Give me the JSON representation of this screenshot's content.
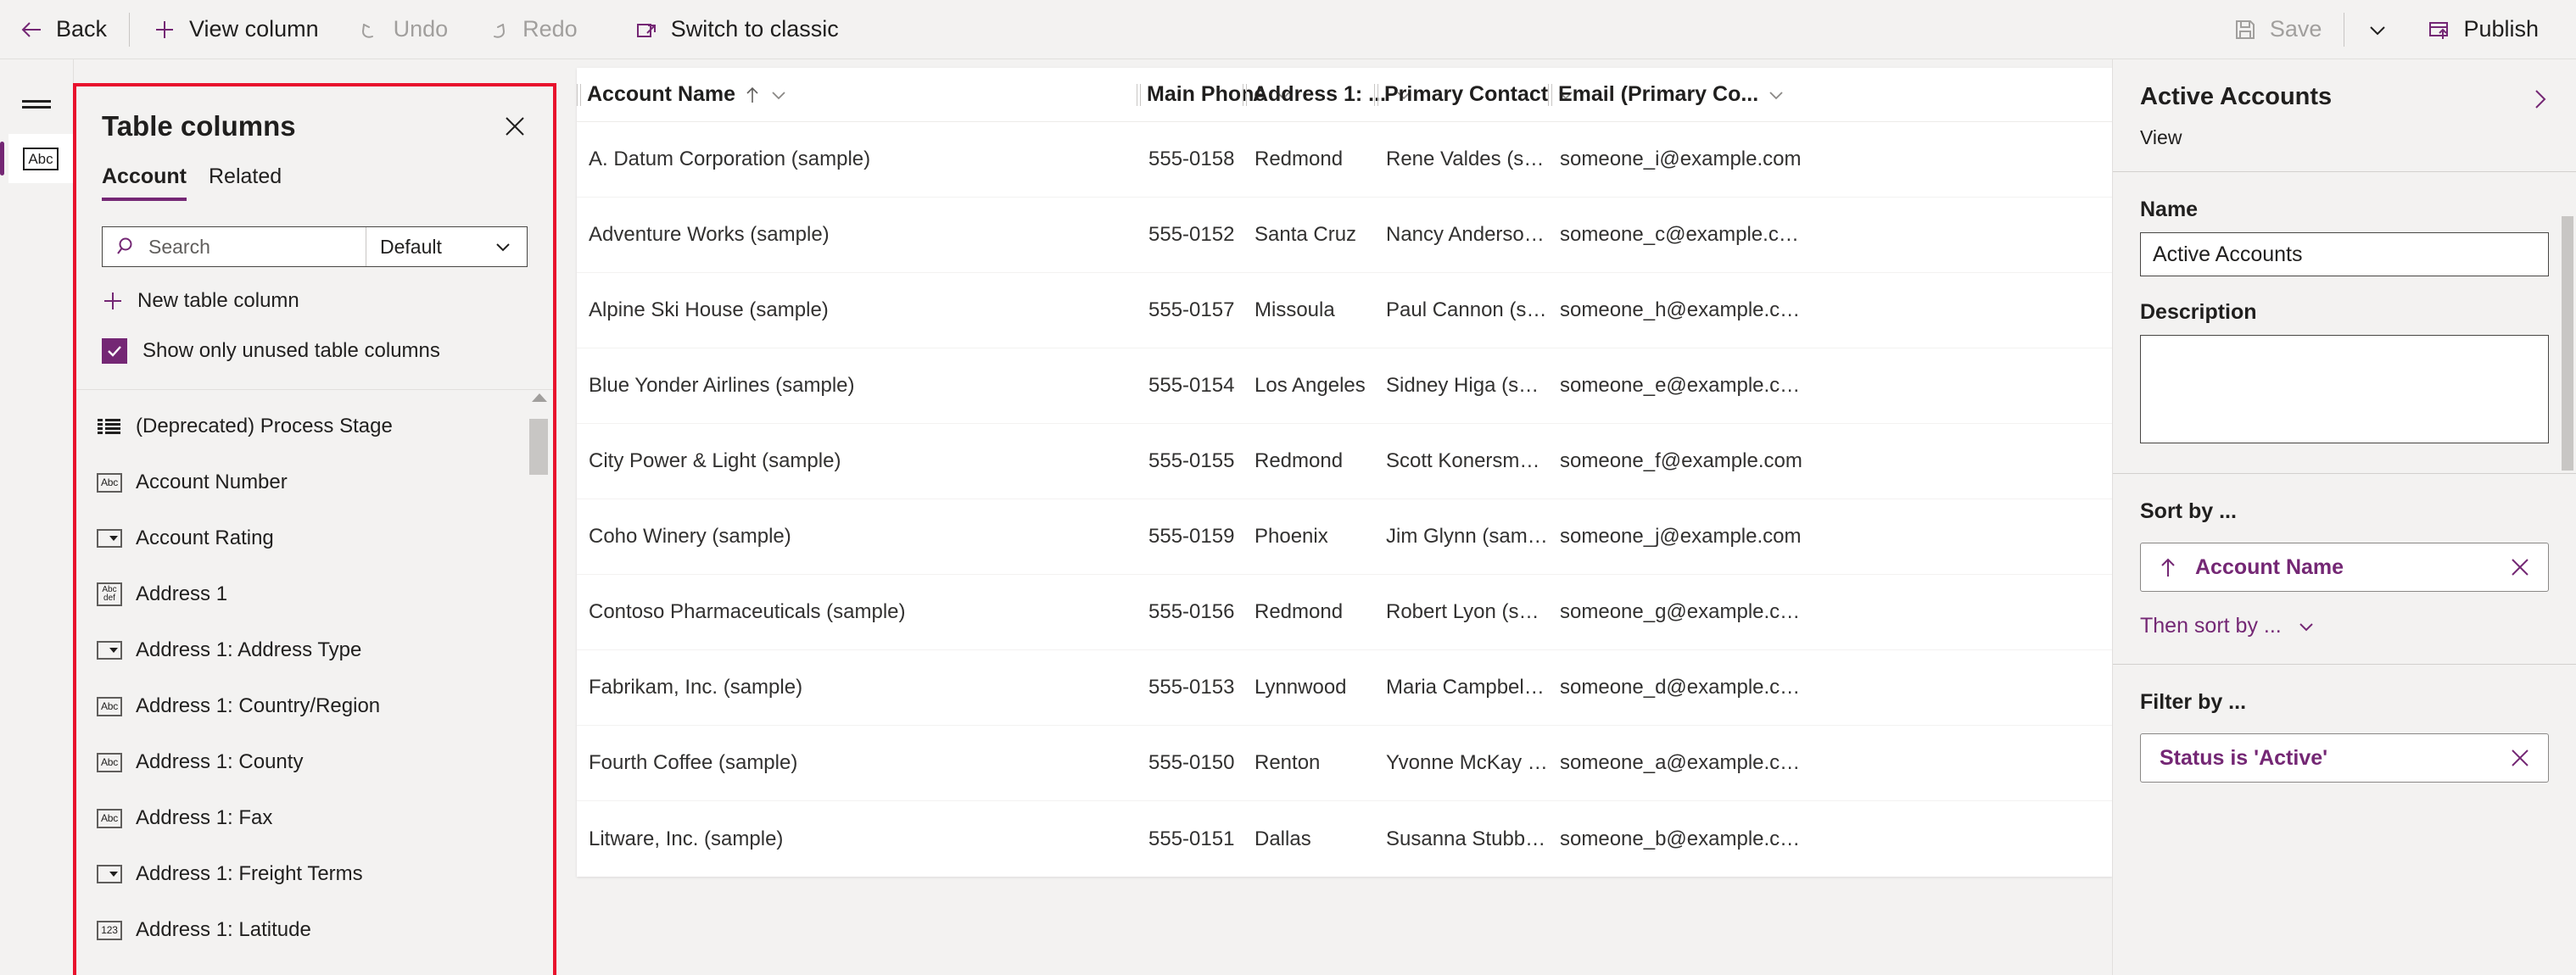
{
  "commandbar": {
    "left": [
      {
        "id": "back",
        "label": "Back",
        "icon": "arrow-left-icon",
        "disabled": false
      },
      {
        "id": "view-column",
        "label": "View column",
        "icon": "plus-icon",
        "disabled": false
      },
      {
        "id": "undo",
        "label": "Undo",
        "icon": "undo-icon",
        "disabled": true
      },
      {
        "id": "redo",
        "label": "Redo",
        "icon": "redo-icon",
        "disabled": true
      },
      {
        "id": "switch-classic",
        "label": "Switch to classic",
        "icon": "open-external-icon",
        "disabled": false
      }
    ],
    "right": [
      {
        "id": "save",
        "label": "Save",
        "icon": "save-icon",
        "disabled": true
      },
      {
        "id": "publish",
        "label": "Publish",
        "icon": "publish-icon",
        "disabled": false
      }
    ],
    "save_chevron": "chevron-down-icon"
  },
  "rail": {
    "menu_icon": "hamburger-icon",
    "item_icon_label": "Abc",
    "item_name": "columns-tool"
  },
  "columns_panel": {
    "title": "Table columns",
    "close_icon": "close-icon",
    "tabs": [
      {
        "label": "Account",
        "active": true
      },
      {
        "label": "Related",
        "active": false
      }
    ],
    "search_placeholder": "Search",
    "search_value": "",
    "search_icon": "search-icon",
    "filter_select_value": "Default",
    "filter_select_icon": "chevron-down-icon",
    "new_column_label": "New table column",
    "new_column_icon": "plus-icon",
    "checkbox_label": "Show only unused table columns",
    "checkbox_checked": true,
    "list": [
      {
        "label": "(Deprecated) Process Stage",
        "icon": "list-type-icon"
      },
      {
        "label": "Account Number",
        "icon": "text-type-icon"
      },
      {
        "label": "Account Rating",
        "icon": "choice-type-icon"
      },
      {
        "label": "Address 1",
        "icon": "multiline-text-type-icon"
      },
      {
        "label": "Address 1: Address Type",
        "icon": "choice-type-icon"
      },
      {
        "label": "Address 1: Country/Region",
        "icon": "text-type-icon"
      },
      {
        "label": "Address 1: County",
        "icon": "text-type-icon"
      },
      {
        "label": "Address 1: Fax",
        "icon": "text-type-icon"
      },
      {
        "label": "Address 1: Freight Terms",
        "icon": "choice-type-icon"
      },
      {
        "label": "Address 1: Latitude",
        "icon": "number-type-icon"
      }
    ],
    "scrollbar": {
      "up_icon": "scroll-up-icon"
    }
  },
  "grid": {
    "columns": [
      {
        "label": "Account Name",
        "sorted": true,
        "sort_icon": "arrow-up-icon",
        "menu_icon": "chevron-down-icon"
      },
      {
        "label": "Main Phone",
        "sorted": false,
        "menu_icon": "chevron-down-icon"
      },
      {
        "label": "Address 1: ...",
        "sorted": false,
        "menu_icon": "chevron-down-icon"
      },
      {
        "label": "Primary Contact",
        "sorted": false,
        "menu_icon": "chevron-down-icon"
      },
      {
        "label": "Email (Primary Co...",
        "sorted": false,
        "menu_icon": "chevron-down-icon"
      }
    ],
    "rows": [
      [
        "A. Datum Corporation (sample)",
        "555-0158",
        "Redmond",
        "Rene Valdes (sample)",
        "someone_i@example.com"
      ],
      [
        "Adventure Works (sample)",
        "555-0152",
        "Santa Cruz",
        "Nancy Anderson (sample)",
        "someone_c@example.com"
      ],
      [
        "Alpine Ski House (sample)",
        "555-0157",
        "Missoula",
        "Paul Cannon (sample)",
        "someone_h@example.com"
      ],
      [
        "Blue Yonder Airlines (sample)",
        "555-0154",
        "Los Angeles",
        "Sidney Higa (sample)",
        "someone_e@example.com"
      ],
      [
        "City Power & Light (sample)",
        "555-0155",
        "Redmond",
        "Scott Konersmann (sample)",
        "someone_f@example.com"
      ],
      [
        "Coho Winery (sample)",
        "555-0159",
        "Phoenix",
        "Jim Glynn (sample)",
        "someone_j@example.com"
      ],
      [
        "Contoso Pharmaceuticals (sample)",
        "555-0156",
        "Redmond",
        "Robert Lyon (sample)",
        "someone_g@example.com"
      ],
      [
        "Fabrikam, Inc. (sample)",
        "555-0153",
        "Lynnwood",
        "Maria Campbell (sample)",
        "someone_d@example.com"
      ],
      [
        "Fourth Coffee (sample)",
        "555-0150",
        "Renton",
        "Yvonne McKay (sample)",
        "someone_a@example.com"
      ],
      [
        "Litware, Inc. (sample)",
        "555-0151",
        "Dallas",
        "Susanna Stubberod (samp...",
        "someone_b@example.com"
      ]
    ]
  },
  "properties": {
    "title": "Active Accounts",
    "subtitle": "View",
    "expand_icon": "chevron-right-icon",
    "name_label": "Name",
    "name_value": "Active Accounts",
    "description_label": "Description",
    "description_value": "",
    "sort_label": "Sort by ...",
    "sort_chip": {
      "label": "Account Name",
      "direction_icon": "arrow-up-icon",
      "remove_icon": "close-icon"
    },
    "then_sort_label": "Then sort by ...",
    "then_sort_icon": "chevron-down-icon",
    "filter_label": "Filter by ...",
    "filter_chip": {
      "label": "Status is 'Active'",
      "remove_icon": "close-icon"
    }
  },
  "colors": {
    "accent": "#742774",
    "highlight_border": "#e8112d",
    "chrome": "#f3f2f1",
    "text": "#201f1e",
    "disabled_text": "#a19f9d"
  }
}
